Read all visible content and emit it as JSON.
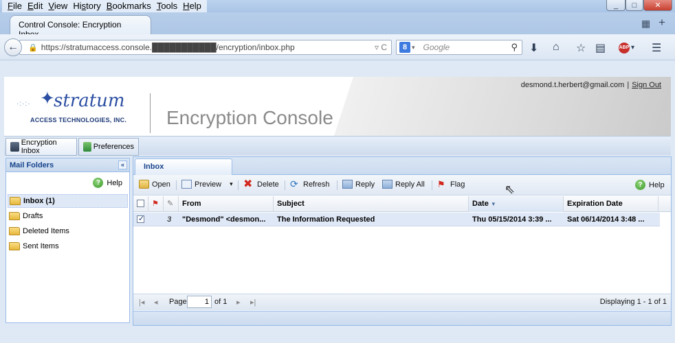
{
  "menubar": {
    "items": [
      "File",
      "Edit",
      "View",
      "History",
      "Bookmarks",
      "Tools",
      "Help"
    ]
  },
  "window_controls": {
    "minimize": "_",
    "restore": "□",
    "close": "✕"
  },
  "tab": {
    "title": "Control Console: Encryption Inbox",
    "new_tab": "+",
    "grid": "▦"
  },
  "nav": {
    "url": "https://stratumaccess.console.███████████/encryption/inbox.php",
    "search_placeholder": "Google",
    "search_engine": "8"
  },
  "header": {
    "user_email": "desmond.t.herbert@gmail.com",
    "separator": "|",
    "sign_out": "Sign Out",
    "logo_brand": "stratum",
    "logo_sub": "ACCESS TECHNOLOGIES, INC.",
    "console_title": "Encryption Console"
  },
  "app_tabs": [
    {
      "label": "Encryption Inbox"
    },
    {
      "label": "Preferences"
    }
  ],
  "left_panel": {
    "title": "Mail Folders",
    "help": "Help",
    "collapse": "«",
    "folders": [
      {
        "label": "Inbox (1)",
        "selected": true
      },
      {
        "label": "Drafts"
      },
      {
        "label": "Deleted Items"
      },
      {
        "label": "Sent Items"
      }
    ]
  },
  "main_panel": {
    "tab": "Inbox",
    "toolbar": {
      "open": "Open",
      "preview": "Preview",
      "delete": "Delete",
      "refresh": "Refresh",
      "reply": "Reply",
      "reply_all": "Reply All",
      "flag": "Flag",
      "help": "Help"
    },
    "columns": {
      "from": "From",
      "subject": "Subject",
      "date": "Date",
      "expiration": "Expiration Date"
    },
    "rows": [
      {
        "attachments": "3",
        "from": "\"Desmond\" <desmon...",
        "subject": "The Information Requested",
        "date": "Thu 05/15/2014 3:39 ...",
        "expiration": "Sat 06/14/2014 3:48 ..."
      }
    ],
    "pager": {
      "page_label": "Page",
      "page_value": "1",
      "of_label": "of 1",
      "displaying": "Displaying 1 - 1 of 1"
    }
  }
}
